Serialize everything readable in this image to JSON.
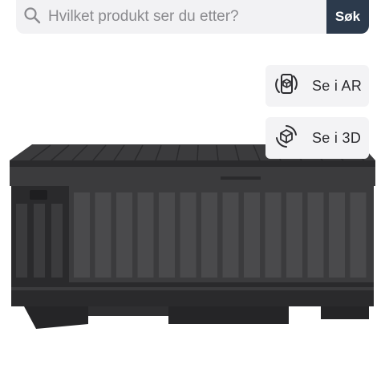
{
  "search": {
    "placeholder": "Hvilket produkt ser du etter?",
    "value": "",
    "button_label": "Søk",
    "icon": "search-icon"
  },
  "viewer": {
    "ar_label": "Se i AR",
    "ar_icon": "ar-phone-cube-icon",
    "three_d_label": "Se i 3D",
    "three_d_icon": "3d-rotate-cube-icon"
  },
  "product": {
    "image": "dark-grey-storage-box",
    "colors": {
      "body": "#3b3b3d",
      "shade": "#2a2a2c",
      "highlight": "#4a4a4c"
    }
  },
  "colors": {
    "search_bg": "#f2f2f4",
    "button_bg": "#2c3a4c",
    "chip_bg": "#f3f3f5"
  }
}
